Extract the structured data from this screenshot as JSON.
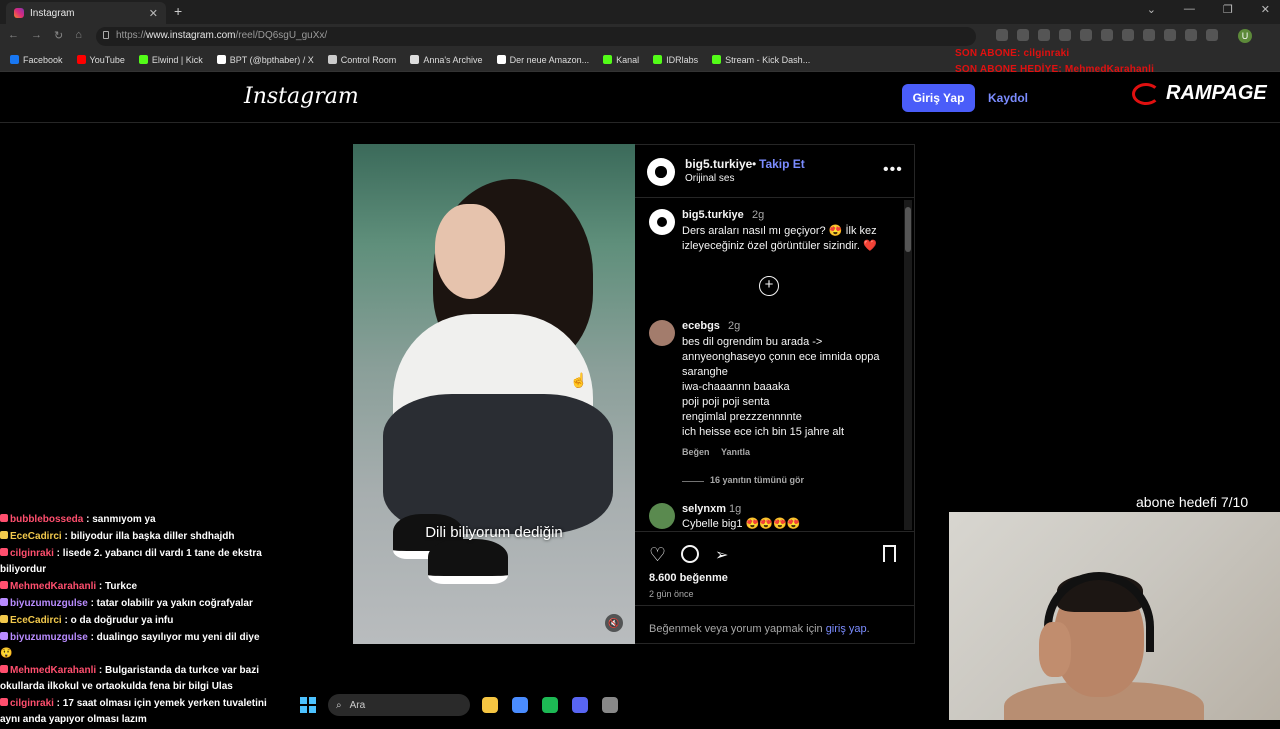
{
  "browser": {
    "tab_title": "Instagram",
    "tab_close": "✕",
    "new_tab": "+",
    "url_prefix": "https://",
    "url_domain": "www.instagram.com",
    "url_path": "/reel/DQ6sgU_guXx/",
    "nav_back": "←",
    "nav_forward": "→",
    "nav_reload": "↻",
    "nav_home": "⌂",
    "window_controls": [
      "⌄",
      "—",
      "❐",
      "✕"
    ],
    "profile_initial": "U",
    "bookmarks": [
      {
        "label": "Facebook",
        "color": "#1877f2"
      },
      {
        "label": "YouTube",
        "color": "#ff0000"
      },
      {
        "label": "Elwind | Kick",
        "color": "#53fc18"
      },
      {
        "label": "BPT (@bpthaber) / X",
        "color": "#ffffff"
      },
      {
        "label": "Control Room",
        "color": "#cccccc"
      },
      {
        "label": "Anna's Archive",
        "color": "#dddddd"
      },
      {
        "label": "Der neue Amazon...",
        "color": "#ffffff"
      },
      {
        "label": "Kanal",
        "color": "#53fc18"
      },
      {
        "label": "IDRlabs",
        "color": "#53fc18"
      },
      {
        "label": "Stream - Kick Dash...",
        "color": "#53fc18"
      }
    ]
  },
  "overlay": {
    "last_sub": "SON ABONE: cilginraki",
    "last_gift": "SON ABONE HEDİYE: MehmedKarahanli",
    "brand": "RAMPAGE",
    "goal": "abone hedefi 7/10"
  },
  "instagram": {
    "logo": "Instagram",
    "login_button": "Giriş Yap",
    "signup_link": "Kaydol"
  },
  "video": {
    "caption": "Dili biliyorum dediğin",
    "mute_icon": "🔇"
  },
  "post": {
    "account": "big5.turkiye",
    "dot": "•",
    "follow": "Takip Et",
    "audio": "Orijinal ses",
    "more": "•••",
    "caption_user": "big5.turkiye",
    "caption_time": "2g",
    "caption_text": "Ders araları nasıl mı geçiyor? 😍 İlk kez izleyeceğiniz özel görüntüler sizindir. ❤️",
    "add_icon": "+",
    "comments": [
      {
        "user": "ecebgs",
        "time": "2g",
        "text": "bes dil ogrendim bu arada ->\nannyeonghaseyo çonın ece imnida oppa saranghe\niwa-chaaannn baaaka\npoji poji poji senta\nrengimlal prezzzennnnte\nich heisse ece ich bin 15 jahre alt",
        "like": "Beğen",
        "reply": "Yanıtla",
        "view_replies": "16 yanıtın tümünü gör"
      },
      {
        "user": "selynxm",
        "time": "1g",
        "text": "Cybelle big1 😍😍😍😍"
      }
    ],
    "like_icon": "♡",
    "share_icon": "➢",
    "likes": "8.600 beğenme",
    "age": "2 gün önce",
    "login_note_prefix": "Beğenmek veya yorum yapmak için ",
    "login_note_link": "giriş yap",
    "login_note_suffix": "."
  },
  "chat": [
    {
      "user": "bubblebosseda",
      "color": "#ff4f6e",
      "text": ": sanmıyom ya"
    },
    {
      "user": "EceCadirci",
      "color": "#f2c94c",
      "text": ": biliyodur illa başka diller shdhajdh"
    },
    {
      "user": "cilginraki",
      "color": "#ff4f6e",
      "text": ": lisede 2. yabancı dil vardı 1 tane de ekstra biliyordur"
    },
    {
      "user": "MehmedKarahanli",
      "color": "#ff4f6e",
      "text": ": Turkce"
    },
    {
      "user": "biyuzumuzgulse",
      "color": "#b98cff",
      "text": ": tatar olabilir ya yakın coğrafyalar"
    },
    {
      "user": "EceCadirci",
      "color": "#f2c94c",
      "text": ": o da doğrudur ya infu"
    },
    {
      "user": "biyuzumuzgulse",
      "color": "#b98cff",
      "text": ": dualingo sayılıyor mu yeni dil diye 😲"
    },
    {
      "user": "MehmedKarahanli",
      "color": "#ff4f6e",
      "text": ": Bulgaristanda da turkce var bazi okullarda ilkokul ve ortaokulda fena bir bilgi Ulas"
    },
    {
      "user": "cilginraki",
      "color": "#ff4f6e",
      "text": ": 17 saat olması için yemek yerken tuvaletini aynı anda yapıyor olması lazım"
    }
  ],
  "taskbar": {
    "search_placeholder": "Ara",
    "search_icon": "⌕",
    "apps": [
      {
        "name": "file-explorer-icon",
        "color": "#f5c542"
      },
      {
        "name": "chrome-icon",
        "color": "#4a8cff"
      },
      {
        "name": "spotify-icon",
        "color": "#1db954"
      },
      {
        "name": "discord-icon",
        "color": "#5865f2"
      },
      {
        "name": "app-icon",
        "color": "#888888"
      }
    ]
  }
}
